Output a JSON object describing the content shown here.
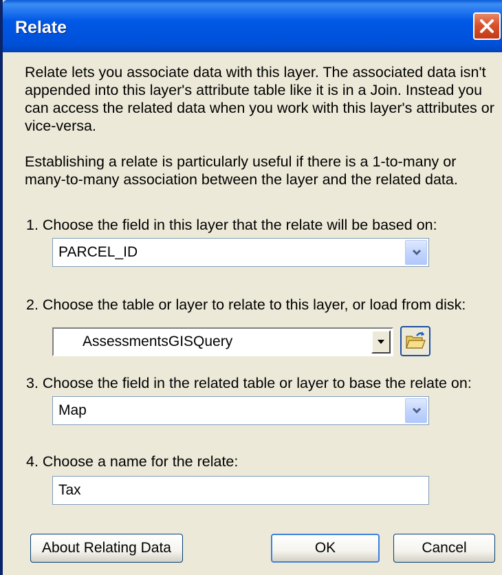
{
  "window": {
    "title": "Relate"
  },
  "description": {
    "para1": "Relate lets you associate data with this layer. The associated data isn't appended into this layer's attribute table like it is in a Join. Instead you can access the related data when you work with this layer's attributes or vice-versa.",
    "para2": "Establishing a relate is particularly useful if there is a 1-to-many or many-to-many association between the layer and the related data."
  },
  "steps": {
    "step1_label": "1. Choose the field in this layer that the relate will be based on:",
    "step1_value": "PARCEL_ID",
    "step2_label": "2. Choose the table or layer to relate to this layer, or load from disk:",
    "step2_value": "AssessmentsGISQuery",
    "step3_label": "3. Choose the field in the related table or layer to base the relate on:",
    "step3_value": "Map",
    "step4_label": "4. Choose a name for the relate:",
    "step4_value": "Tax"
  },
  "buttons": {
    "about": "About Relating Data",
    "ok": "OK",
    "cancel": "Cancel"
  },
  "icons": {
    "close": "close-icon",
    "dropdown": "chevron-down-icon",
    "open_folder": "open-folder-icon"
  },
  "colors": {
    "titlebar": "#0058e6",
    "dialog_bg": "#ece9d8",
    "close_button": "#d8532d",
    "field_border": "#7f9db9"
  }
}
